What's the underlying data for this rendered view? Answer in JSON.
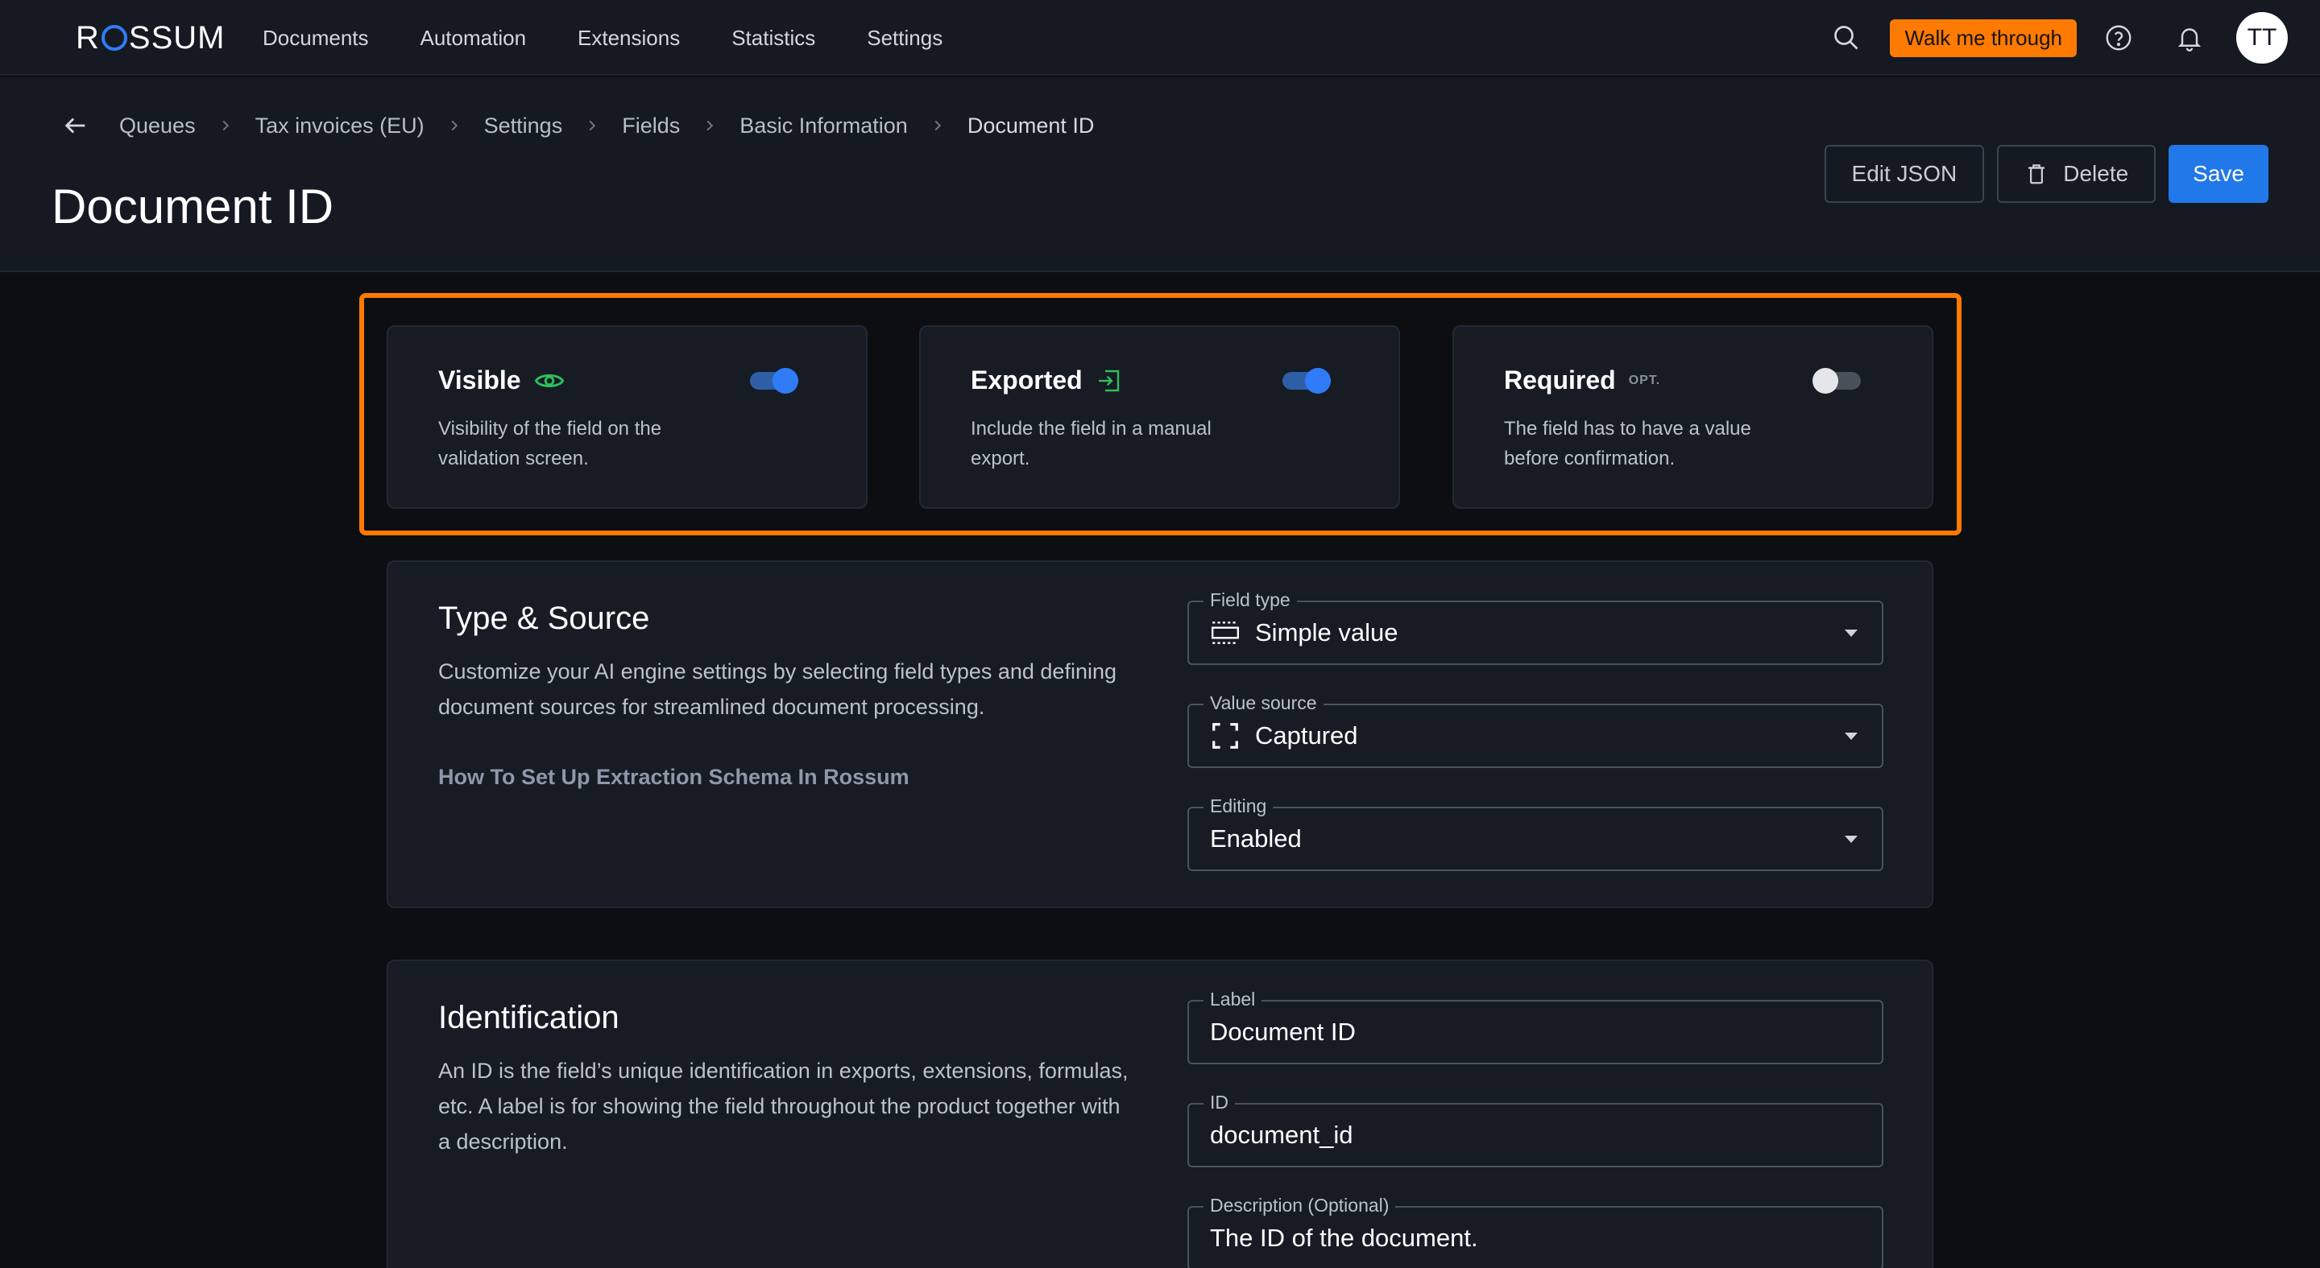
{
  "app": {
    "logo_text": "ROSSUM"
  },
  "nav": {
    "items": [
      "Documents",
      "Automation",
      "Extensions",
      "Statistics",
      "Settings"
    ],
    "walk_label": "Walk me through",
    "avatar_initials": "TT",
    "icons": [
      "search-icon",
      "help-icon",
      "bell-icon"
    ]
  },
  "breadcrumb": {
    "items": [
      "Queues",
      "Tax invoices (EU)",
      "Settings",
      "Fields",
      "Basic Information",
      "Document ID"
    ]
  },
  "page": {
    "title": "Document ID"
  },
  "actions": {
    "edit_json": "Edit JSON",
    "delete": "Delete",
    "save": "Save"
  },
  "toggles": [
    {
      "title": "Visible",
      "icon": "eye-icon",
      "desc": "Visibility of the field on the validation screen.",
      "on": true
    },
    {
      "title": "Exported",
      "icon": "export-icon",
      "desc": "Include the field in a manual export.",
      "on": true
    },
    {
      "title": "Required",
      "opt": "OPT.",
      "desc": "The field has to have a value before confirmation.",
      "on": false
    }
  ],
  "type_source": {
    "title": "Type & Source",
    "desc": "Customize your AI engine settings by selecting field types and defining document sources for streamlined document processing.",
    "link": "How To Set Up Extraction Schema In Rossum",
    "field_type": {
      "label": "Field type",
      "value": "Simple value"
    },
    "value_source": {
      "label": "Value source",
      "value": "Captured"
    },
    "editing": {
      "label": "Editing",
      "value": "Enabled"
    }
  },
  "identification": {
    "title": "Identification",
    "desc": "An ID is the field’s unique identification in exports, extensions, formulas, etc. A label is for showing the field throughout the product together with a description.",
    "label_field": {
      "label": "Label",
      "value": "Document ID"
    },
    "id_field": {
      "label": "ID",
      "value": "document_id"
    },
    "description_field": {
      "label": "Description (Optional)",
      "value": "The ID of the document."
    }
  },
  "colors": {
    "accent": "#2f7cf6",
    "highlight": "#ff7a00",
    "success": "#2ec15b"
  }
}
